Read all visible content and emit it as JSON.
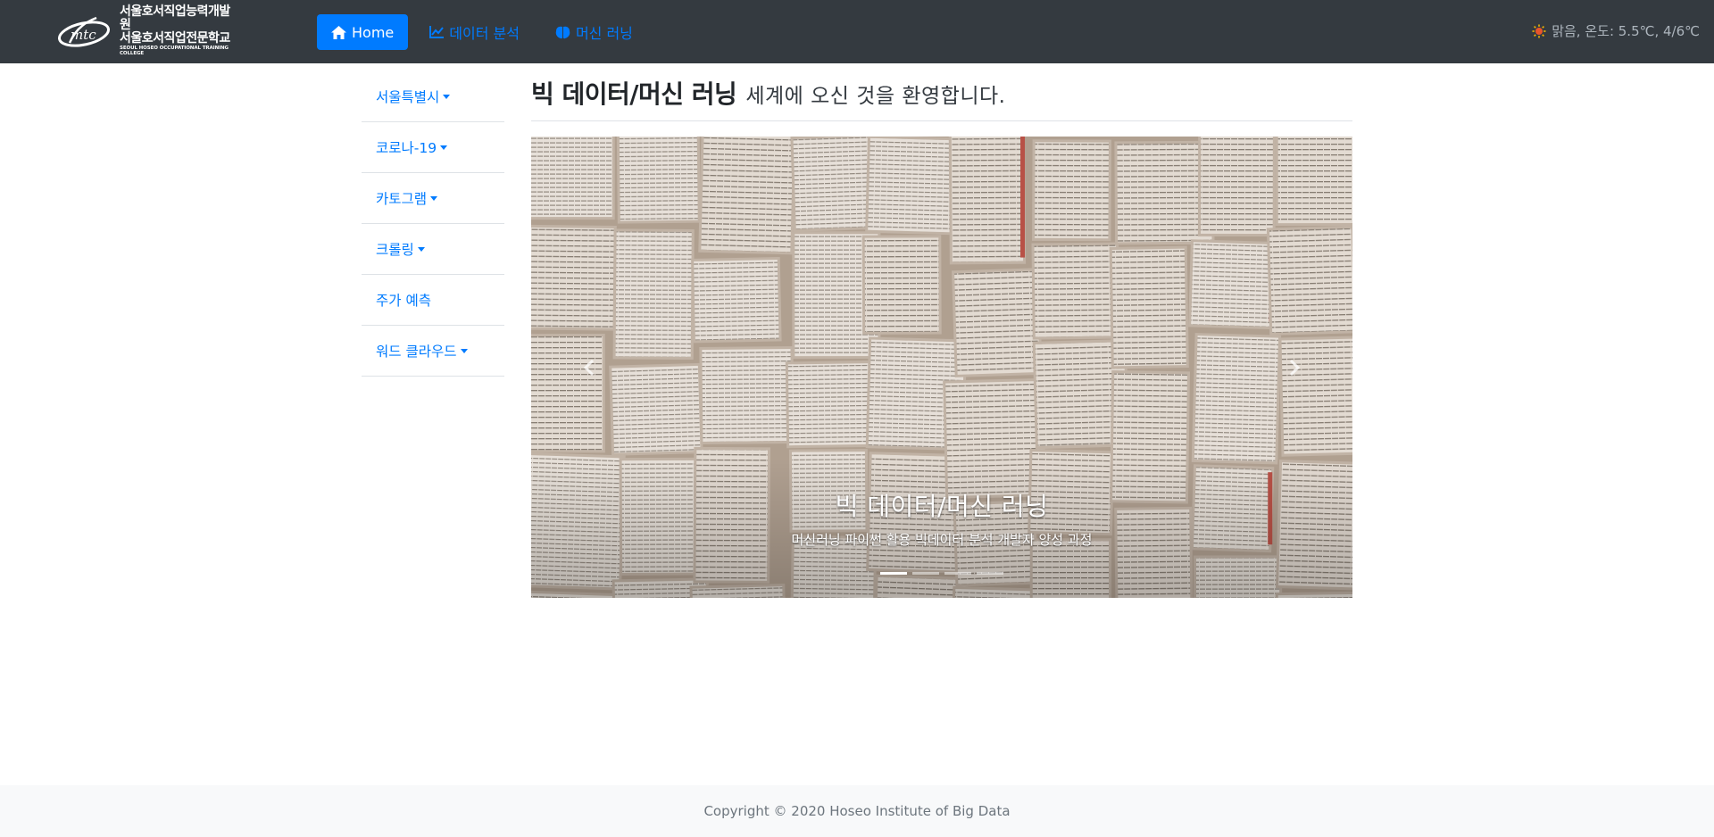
{
  "navbar": {
    "brand": {
      "line1": "서울호서직업능력개발원",
      "line2": "서울호서직업전문학교",
      "line3": "SEOUL HOSEO OCCUPATIONAL TRAINING COLLEGE"
    },
    "items": [
      {
        "label": "Home",
        "icon": "home-icon",
        "active": true
      },
      {
        "label": "데이터 분석",
        "icon": "line-chart-icon",
        "active": false
      },
      {
        "label": "머신 러닝",
        "icon": "brain-icon",
        "active": false
      }
    ],
    "weather": {
      "icon": "sun-icon",
      "text": "맑음, 온도: 5.5℃, 4/6℃"
    }
  },
  "sidebar": {
    "items": [
      {
        "label": "서울특별시",
        "dropdown": true
      },
      {
        "label": "코로나-19",
        "dropdown": true
      },
      {
        "label": "카토그램",
        "dropdown": true
      },
      {
        "label": "크롤링",
        "dropdown": true
      },
      {
        "label": "주가 예측",
        "dropdown": false
      },
      {
        "label": "워드 클라우드",
        "dropdown": true
      }
    ]
  },
  "main": {
    "heading_bold": "빅 데이터/머신 러닝",
    "heading_light": "세계에 오신 것을 환영합니다.",
    "carousel": {
      "caption_title": "빅 데이터/머신 러닝",
      "caption_text": "머신러닝 파이썬 활용 빅데이터 분석 개발자 양성 과정",
      "slides": 4,
      "active_index": 0
    }
  },
  "footer": {
    "text": "Copyright © 2020 Hoseo Institute of Big Data"
  },
  "colors": {
    "navbar": "#343a40",
    "primary": "#007bff",
    "footer_bg": "#f8f9fa"
  }
}
